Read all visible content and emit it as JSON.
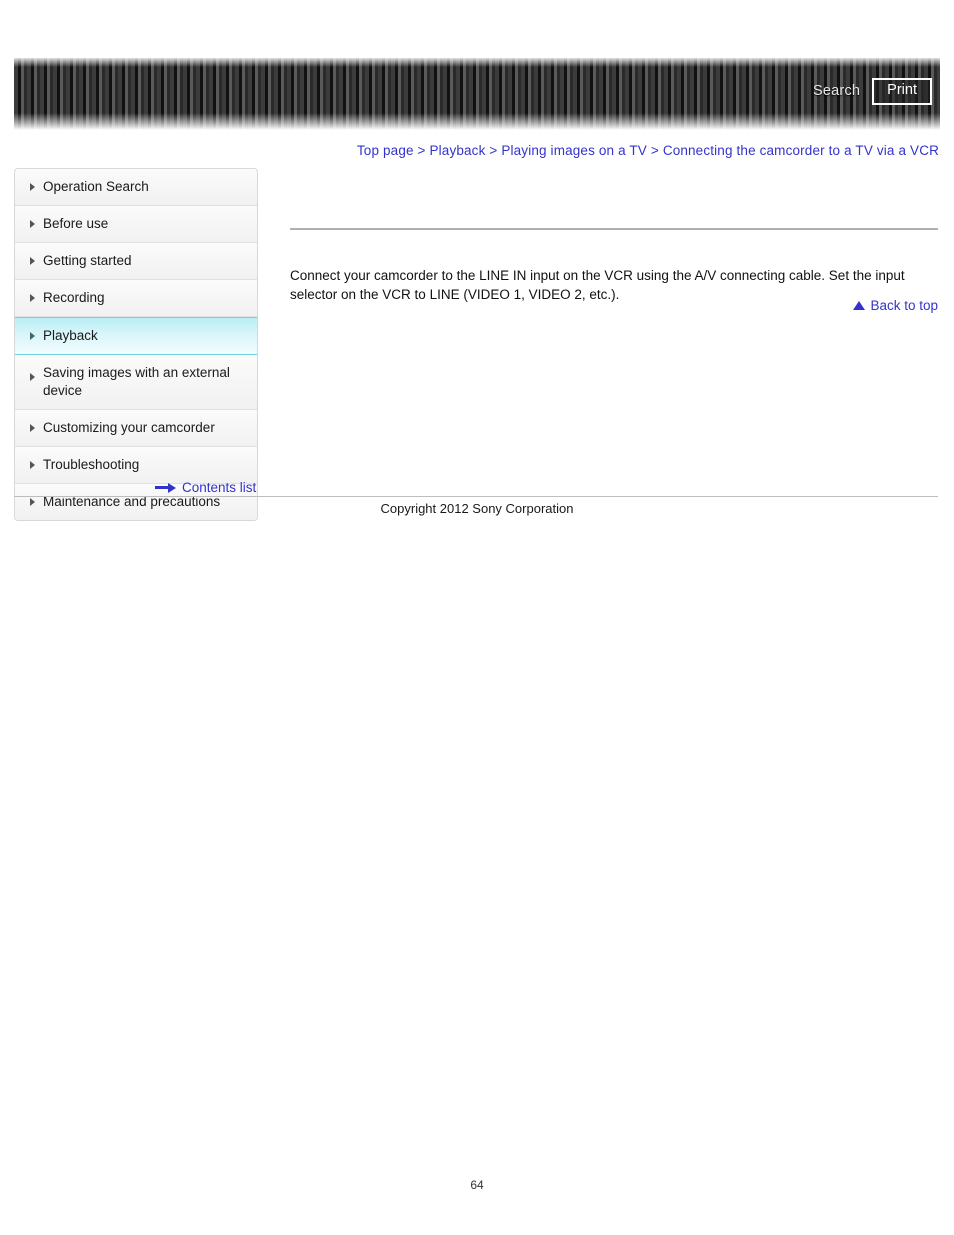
{
  "header": {
    "search_label": "Search",
    "print_label": "Print"
  },
  "breadcrumb": {
    "separator": " > ",
    "items": [
      {
        "label": "Top page"
      },
      {
        "label": "Playback"
      },
      {
        "label": "Playing images on a TV"
      },
      {
        "label": "Connecting the camcorder to a TV via a VCR"
      }
    ]
  },
  "sidebar": {
    "items": [
      {
        "label": "Operation Search",
        "active": false
      },
      {
        "label": "Before use",
        "active": false
      },
      {
        "label": "Getting started",
        "active": false
      },
      {
        "label": "Recording",
        "active": false
      },
      {
        "label": "Playback",
        "active": true
      },
      {
        "label": "Saving images with an external device",
        "active": false
      },
      {
        "label": "Customizing your camcorder",
        "active": false
      },
      {
        "label": "Troubleshooting",
        "active": false
      },
      {
        "label": "Maintenance and precautions",
        "active": false
      }
    ],
    "contents_list_label": "Contents list"
  },
  "main": {
    "body_text": "Connect your camcorder to the LINE IN input on the VCR using the A/V connecting cable. Set the input selector on the VCR to LINE (VIDEO 1, VIDEO 2, etc.).",
    "back_to_top_label": "Back to top"
  },
  "footer": {
    "copyright": "Copyright 2012 Sony Corporation",
    "page_number": "64"
  },
  "colors": {
    "link": "#3333cc",
    "active_nav": "#b8eef5",
    "header_dark": "#2a2a2a",
    "rule": "#b0b0b0"
  }
}
